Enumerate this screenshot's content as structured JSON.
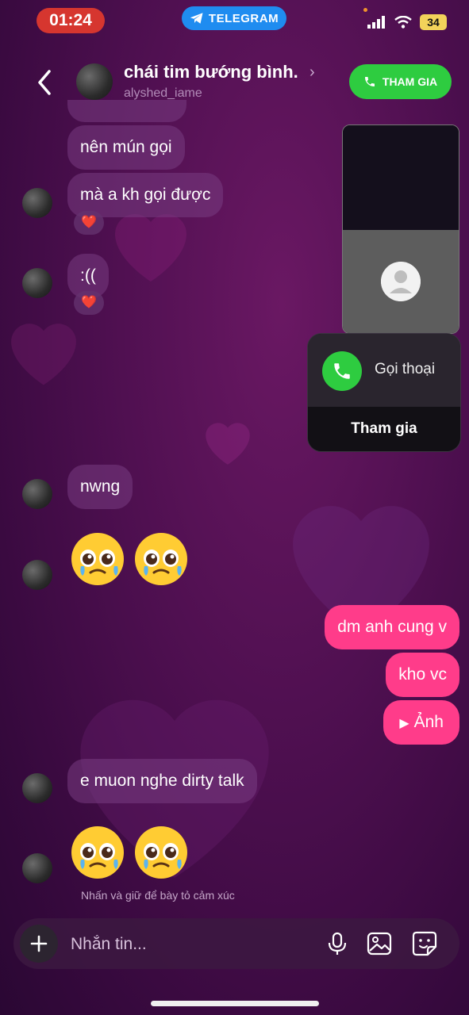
{
  "status": {
    "time": "01:24",
    "source_app": "TELEGRAM",
    "battery": "34"
  },
  "header": {
    "name": "chái tim bướng bình.",
    "username": "alyshed_iame",
    "join_label": "THAM GIA"
  },
  "messages": [
    {
      "from": "them",
      "text": "nên mún gọi"
    },
    {
      "from": "them",
      "text": "mà a kh gọi được",
      "reaction": "❤️"
    },
    {
      "from": "them",
      "text": ":((",
      "reaction": "❤️"
    },
    {
      "from": "them",
      "text": "nwng"
    },
    {
      "from": "them",
      "type": "emoji",
      "text": "🥹🥹"
    },
    {
      "from": "me",
      "text": "dm anh cung v"
    },
    {
      "from": "me",
      "text": "kho vc"
    },
    {
      "from": "me",
      "type": "media",
      "text": "Ảnh"
    },
    {
      "from": "them",
      "text": "e muon nghe dirty talk"
    },
    {
      "from": "them",
      "type": "emoji",
      "text": "🥹🥹"
    }
  ],
  "call": {
    "type_label": "Gọi thoại",
    "join_label": "Tham gia"
  },
  "hint": "Nhấn và giữ để bày tỏ cảm xúc",
  "composer": {
    "placeholder": "Nhắn tin..."
  },
  "colors": {
    "accent_pink": "#ff3c8a",
    "call_green": "#2ecc40",
    "telegram_blue": "#1f8cf0"
  }
}
